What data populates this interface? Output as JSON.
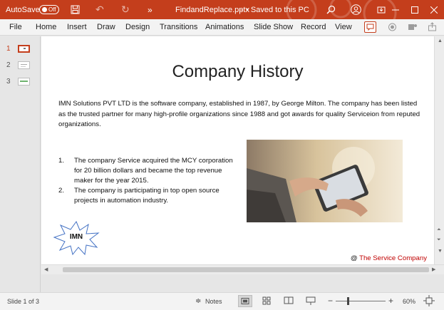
{
  "titlebar": {
    "autosave_label": "AutoSave",
    "autosave_state": "Off",
    "filename": "FindandReplace.pptx",
    "filename_sep": "-",
    "save_status": "• Saved to this PC",
    "more": "»"
  },
  "ribbon": {
    "tabs": [
      "File",
      "Home",
      "Insert",
      "Draw",
      "Design",
      "Transitions",
      "Animations",
      "Slide Show",
      "Record",
      "View"
    ]
  },
  "thumbnails": {
    "numbers": [
      "1",
      "2",
      "3"
    ]
  },
  "slide": {
    "title": "Company History",
    "paragraph": "IMN Solutions PVT LTD is the software company, established in 1987, by George Milton. The company has been listed as the trusted partner for many high-profile organizations since 1988 and got awards for quality Serviceion from reputed organizations.",
    "list": [
      {
        "num": "1.",
        "text": "The company Service acquired the MCY corporation for 20 billion dollars and became the top revenue maker for the year 2015."
      },
      {
        "num": "2.",
        "text": "The company is participating in top open source projects in automation industry."
      }
    ],
    "burst_label": "IMN",
    "footer_at": "@",
    "footer_text": "The Service Company"
  },
  "status": {
    "slide_info": "Slide 1 of 3",
    "notes": "Notes",
    "zoom_minus": "−",
    "zoom_plus": "+",
    "zoom": "60%"
  },
  "colors": {
    "titlebar": "#c43e1c",
    "accent": "#c43e1c",
    "footer_red": "#c00000"
  }
}
